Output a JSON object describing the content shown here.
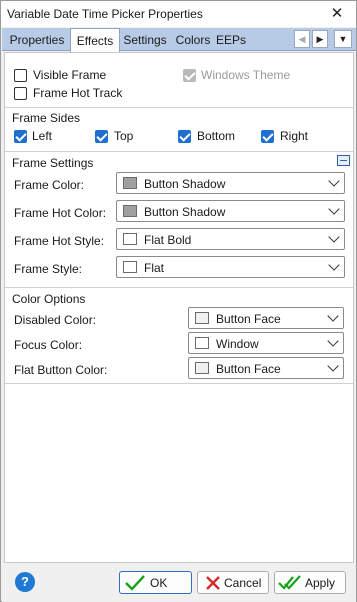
{
  "window": {
    "title": "Variable Date Time Picker Properties",
    "close_glyph": "✕"
  },
  "tabs": [
    {
      "label": "Properties",
      "active": false
    },
    {
      "label": "Effects",
      "active": true
    },
    {
      "label": "Settings",
      "active": false
    },
    {
      "label": "Colors",
      "active": false
    },
    {
      "label": "EEPs",
      "active": false
    }
  ],
  "tab_scroll": {
    "left_glyph": "◀",
    "right_glyph": "▶",
    "menu_glyph": "▼"
  },
  "options": {
    "visible_frame": {
      "label": "Visible Frame",
      "checked": false
    },
    "frame_hot_track": {
      "label": "Frame Hot Track",
      "checked": false
    },
    "windows_theme": {
      "label": "Windows Theme",
      "checked": true,
      "disabled": true
    }
  },
  "frame_sides": {
    "title": "Frame Sides",
    "left": {
      "label": "Left",
      "checked": true
    },
    "top": {
      "label": "Top",
      "checked": true
    },
    "bottom": {
      "label": "Bottom",
      "checked": true
    },
    "right": {
      "label": "Right",
      "checked": true
    }
  },
  "frame_settings": {
    "title": "Frame Settings",
    "frame_color": {
      "label": "Frame Color:",
      "value": "Button Shadow",
      "swatch": "#a0a0a0"
    },
    "frame_hot_color": {
      "label": "Frame Hot Color:",
      "value": "Button Shadow",
      "swatch": "#a0a0a0"
    },
    "frame_hot_style": {
      "label": "Frame Hot Style:",
      "value": "Flat Bold",
      "swatch": "#ffffff"
    },
    "frame_style": {
      "label": "Frame Style:",
      "value": "Flat",
      "swatch": "#ffffff"
    }
  },
  "color_options": {
    "title": "Color Options",
    "disabled_color": {
      "label": "Disabled Color:",
      "value": "Button Face",
      "swatch": "#f0f0f0"
    },
    "focus_color": {
      "label": "Focus Color:",
      "value": "Window",
      "swatch": "#ffffff"
    },
    "flat_button_color": {
      "label": "Flat Button Color:",
      "value": "Button Face",
      "swatch": "#f0f0f0"
    }
  },
  "footer": {
    "help_glyph": "?",
    "ok_label": "OK",
    "cancel_label": "Cancel",
    "apply_label": "Apply"
  },
  "colors": {
    "accent": "#1f6fd1",
    "tab_strip": "#b7cbe6",
    "ok_check": "#1aa31a",
    "cancel_x": "#d42a2a"
  }
}
